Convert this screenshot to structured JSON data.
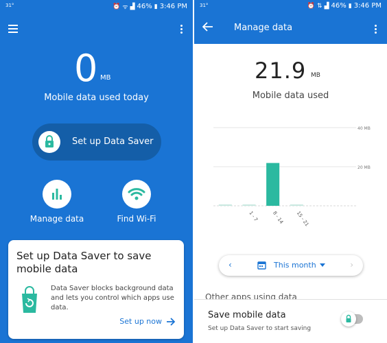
{
  "colors": {
    "primary": "#1a74d4",
    "accent_green": "#2bb9a0",
    "pill_dark": "#145ea8"
  },
  "status_bar": {
    "left_text": "31°",
    "battery": "46%",
    "time": "3:46 PM"
  },
  "home": {
    "usage_value": "0",
    "usage_unit": "MB",
    "usage_caption": "Mobile data used today",
    "saver_button_label": "Set up Data Saver",
    "manage_data_label": "Manage data",
    "find_wifi_label": "Find Wi-Fi",
    "card": {
      "title": "Set up Data Saver to save mobile data",
      "body": "Data Saver blocks background data and lets you control which apps use data.",
      "cta": "Set up now"
    }
  },
  "manage": {
    "title": "Manage data",
    "usage_value": "21.9",
    "usage_unit": "MB",
    "usage_caption": "Mobile data used",
    "period_label": "This month",
    "other_apps_heading": "Other apps using data",
    "save_title": "Save mobile data",
    "save_subtitle": "Set up Data Saver to start saving",
    "toggle_on": false
  },
  "chart_data": {
    "type": "bar",
    "categories": [
      "",
      "1 - 7",
      "8 - 14",
      "15 - 21",
      "",
      ""
    ],
    "values": [
      0.3,
      0.5,
      21.9,
      0.3,
      0,
      0
    ],
    "y_gridlines": [
      {
        "value": 40,
        "label": "40 MB"
      },
      {
        "value": 20,
        "label": "20 MB"
      }
    ],
    "ylim": [
      0,
      40
    ],
    "grid": true,
    "bar_color": "#2bb9a0"
  }
}
